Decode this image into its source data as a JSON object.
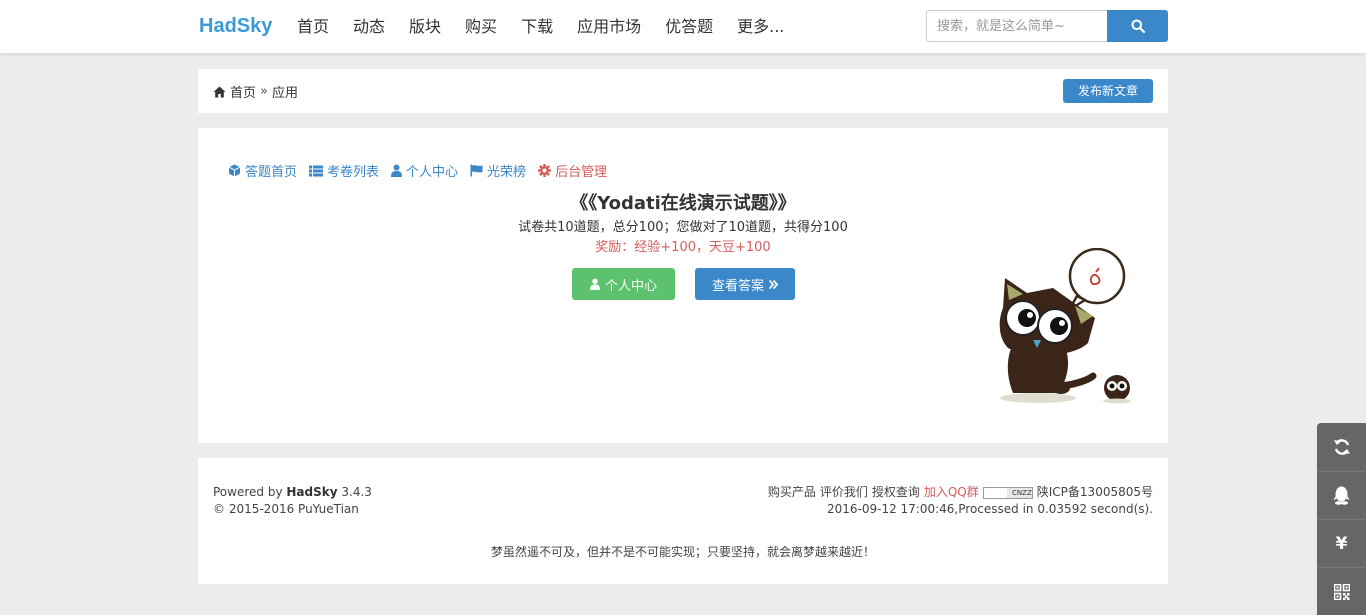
{
  "brand": "HadSky",
  "nav": [
    {
      "label": "首页"
    },
    {
      "label": "动态"
    },
    {
      "label": "版块"
    },
    {
      "label": "购买"
    },
    {
      "label": "下载"
    },
    {
      "label": "应用市场"
    },
    {
      "label": "优答题"
    },
    {
      "label": "更多..."
    }
  ],
  "search": {
    "placeholder": "搜索，就是这么简单~"
  },
  "breadcrumb": {
    "home": "首页",
    "separator": "»",
    "current": "应用"
  },
  "post_button": "发布新文章",
  "subnav": {
    "home": "答题首页",
    "exam_list": "考卷列表",
    "user_center": "个人中心",
    "honor": "光荣榜",
    "admin": "后台管理"
  },
  "exam": {
    "title": "《《Yodati在线演示试题》》",
    "summary": "试卷共10道题，总分100；您做对了10道题，共得分100",
    "reward": "奖励：经验+100，天豆+100"
  },
  "buttons": {
    "user_center": "个人中心",
    "view_answers": "查看答案"
  },
  "footer": {
    "powered_prefix": "Powered by",
    "powered_name": "HadSky",
    "powered_version": "3.4.3",
    "copyright": "© 2015-2016 PuYueTian",
    "links": {
      "buy": "购买产品",
      "rate": "评价我们",
      "license": "授权查询",
      "qq": "加入QQ群"
    },
    "cnzz": "CNZZ",
    "icp": "陕ICP备13005805号",
    "processed": "2016-09-12 17:00:46,Processed in 0.03592 second(s).",
    "slogan": "梦虽然遥不可及，但并不是不可能实现；只要坚持，就会离梦越来越近！"
  },
  "side_toolbar": {
    "yen": "¥"
  },
  "colors": {
    "brand": "#3a9ad9",
    "primary": "#3a87c9",
    "success": "#5cc26f",
    "danger": "#d35d5d",
    "toolbar": "#666666"
  },
  "icons": [
    "search-icon",
    "home-icon",
    "cube-icon",
    "list-icon",
    "user-icon",
    "flag-icon",
    "gear-icon",
    "angle-double-right-icon",
    "refresh-icon",
    "qq-icon",
    "yen-icon",
    "qrcode-icon"
  ]
}
